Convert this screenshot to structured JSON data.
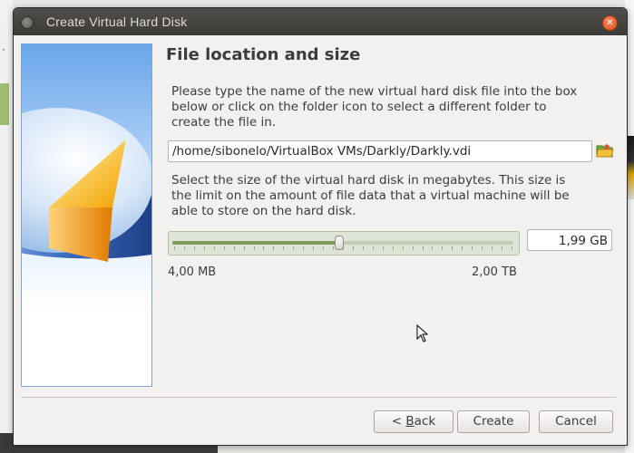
{
  "window": {
    "title": "Create Virtual Hard Disk"
  },
  "page": {
    "heading": "File location and size",
    "location_text": "Please type the name of the new virtual hard disk file into the box below or click on the folder icon to select a different folder to create the file in.",
    "file_path": "/home/sibonelo/VirtualBox VMs/Darkly/Darkly.vdi",
    "size_text": "Select the size of the virtual hard disk in megabytes. This size is the limit on the amount of file data that a virtual machine will be able to store on the hard disk.",
    "size_value": "1,99 GB",
    "slider_fraction": 0.49,
    "range_min": "4,00 MB",
    "range_max": "2,00 TB"
  },
  "buttons": {
    "back_prefix": "< ",
    "back_key": "B",
    "back_rest": "ack",
    "create": "Create",
    "cancel": "Cancel"
  },
  "icons": {
    "close": "close-icon",
    "folder": "folder-icon",
    "window": "window-menu-icon"
  },
  "colors": {
    "titlebar": "#3d3b37",
    "close": "#df4b16",
    "slider_fill": "#7e9b5a",
    "panel_border": "#7aa7d6"
  }
}
